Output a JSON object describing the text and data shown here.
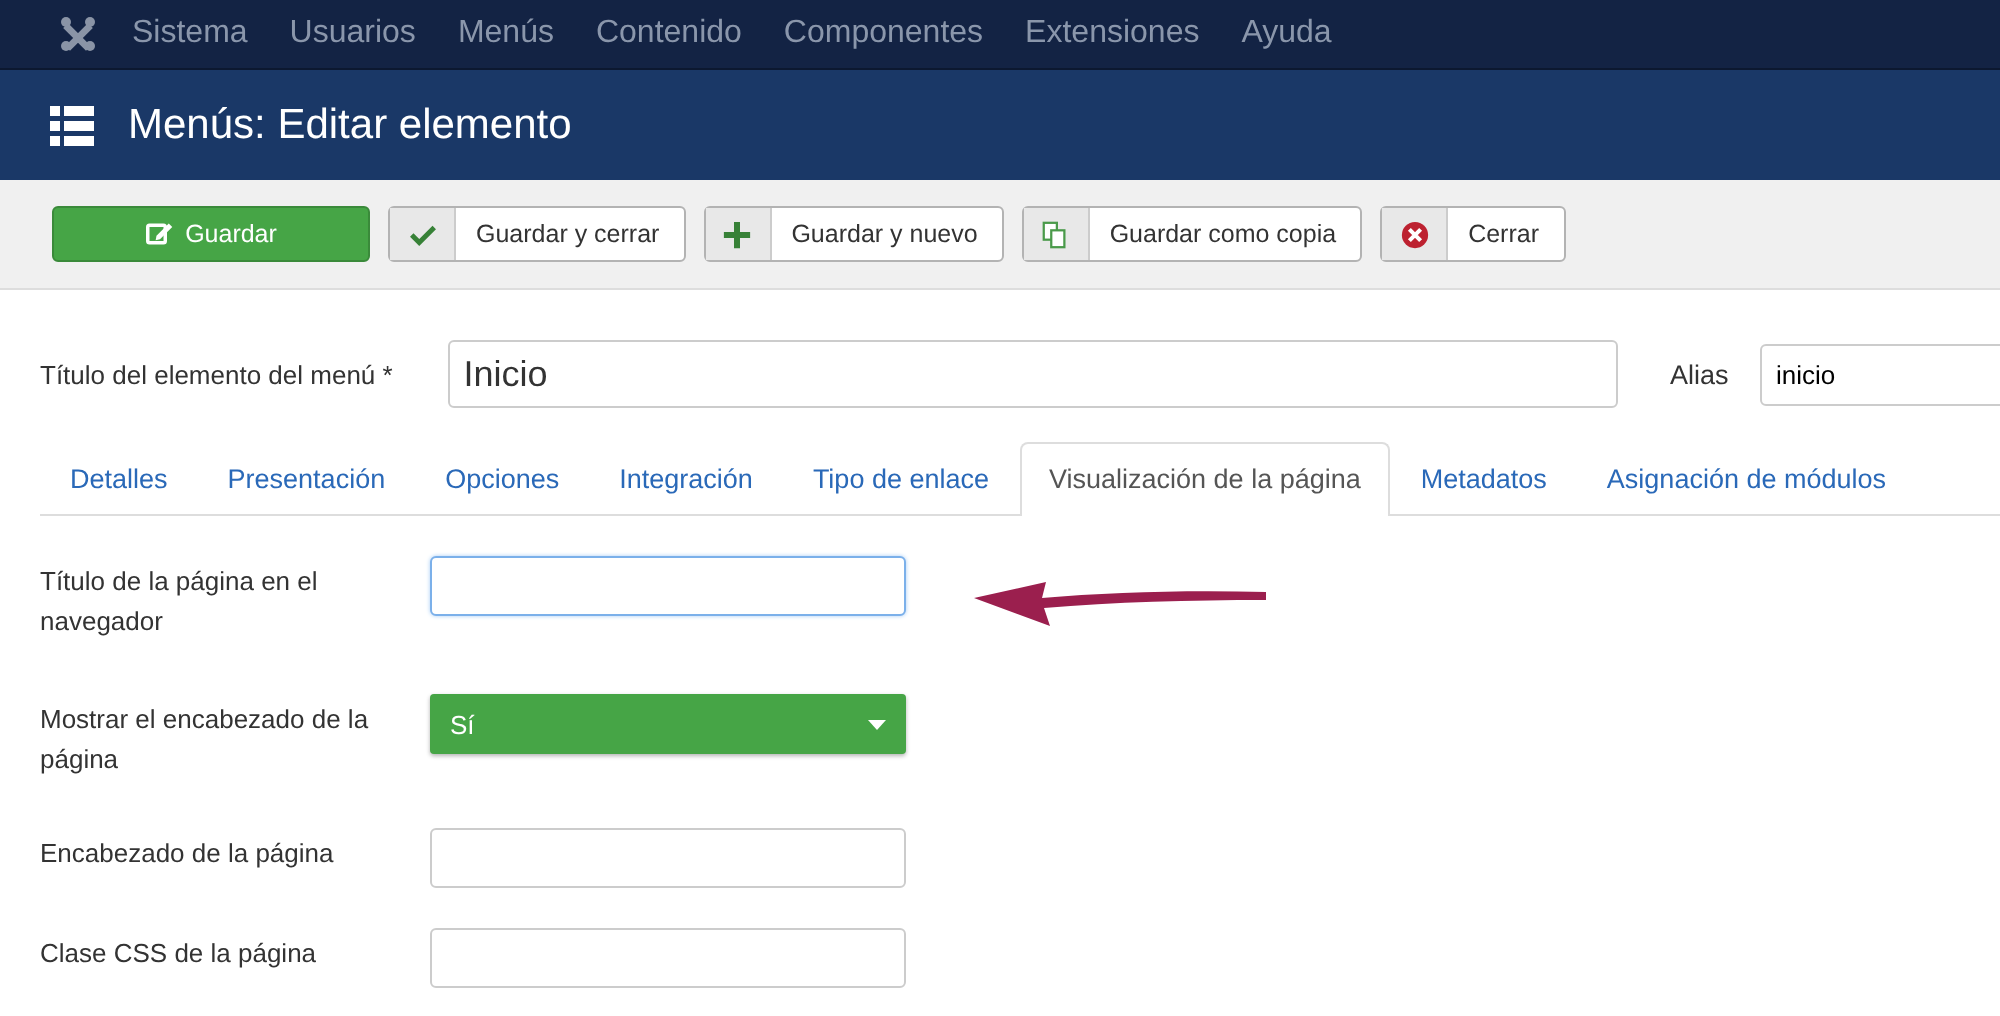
{
  "top_menu": [
    {
      "label": "Sistema"
    },
    {
      "label": "Usuarios"
    },
    {
      "label": "Menús"
    },
    {
      "label": "Contenido"
    },
    {
      "label": "Componentes"
    },
    {
      "label": "Extensiones"
    },
    {
      "label": "Ayuda"
    }
  ],
  "header": {
    "title": "Menús: Editar elemento"
  },
  "toolbar": [
    {
      "label": "Guardar",
      "kind": "primary"
    },
    {
      "label": "Guardar y cerrar",
      "kind": "default"
    },
    {
      "label": "Guardar y nuevo",
      "kind": "default"
    },
    {
      "label": "Guardar como copia",
      "kind": "default"
    },
    {
      "label": "Cerrar",
      "kind": "default"
    }
  ],
  "title_field": {
    "label": "Título del elemento del menú *",
    "value": "Inicio"
  },
  "alias_field": {
    "label": "Alias",
    "value": "inicio"
  },
  "tabs": [
    {
      "label": "Detalles",
      "selected": false
    },
    {
      "label": "Presentación",
      "selected": false
    },
    {
      "label": "Opciones",
      "selected": false
    },
    {
      "label": "Integración",
      "selected": false
    },
    {
      "label": "Tipo de enlace",
      "selected": false
    },
    {
      "label": "Visualización de la página",
      "selected": true
    },
    {
      "label": "Metadatos",
      "selected": false
    },
    {
      "label": "Asignación de módulos",
      "selected": false
    }
  ],
  "fields": [
    {
      "label": "Título de la página en el navegador",
      "kind": "text",
      "focused": true,
      "annotated": true
    },
    {
      "label": "Mostrar el encabezado de la página",
      "kind": "select",
      "value": "Sí",
      "focused": false,
      "annotated": false
    },
    {
      "label": "Encabezado de la página",
      "kind": "text",
      "focused": false,
      "annotated": false
    },
    {
      "label": "Clase CSS de la página",
      "kind": "text",
      "focused": false,
      "annotated": false
    }
  ]
}
